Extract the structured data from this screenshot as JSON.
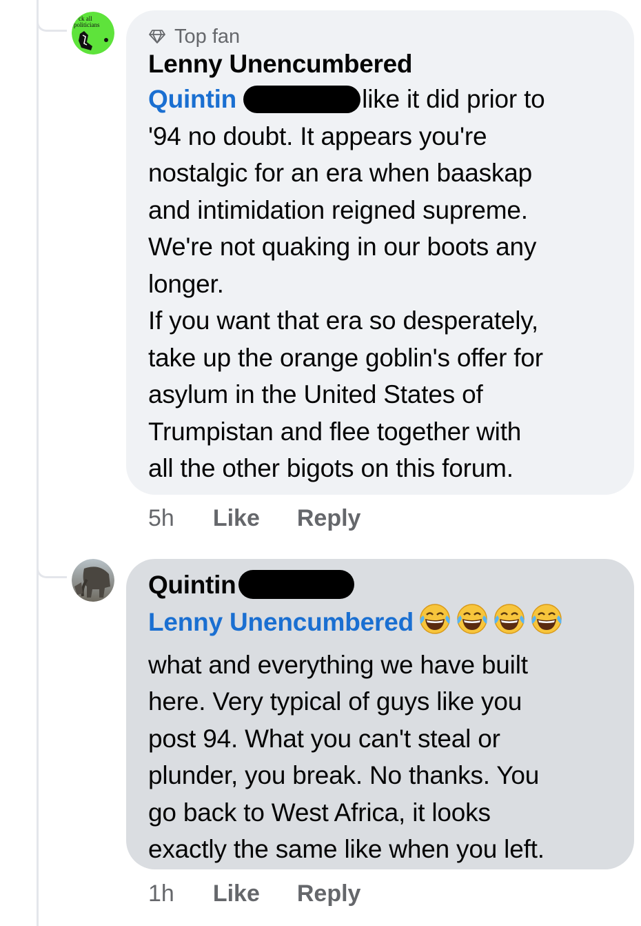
{
  "comments": [
    {
      "badge": "Top fan",
      "author": "Lenny Unencumbered",
      "avatar_text": [
        "ck all",
        "politicians"
      ],
      "mention": "Quintin",
      "text_first": "like it did prior to",
      "lines": [
        "'94 no doubt. It appears you're",
        "nostalgic for an era when baaskap",
        "and intimidation reigned supreme.",
        "We're not quaking in our boots any",
        "longer.",
        "If you want that era so desperately,",
        "take up the orange goblin's offer for",
        "asylum in the United States of",
        "Trumpistan and flee together with",
        "all the other bigots on this forum."
      ],
      "time": "5h",
      "like_label": "Like",
      "reply_label": "Reply"
    },
    {
      "author": "Quintin",
      "mention": "Lenny Unencumbered",
      "emoji": "😂😂😂😂",
      "lines": [
        "what and everything we have built",
        "here. Very typical of guys like you",
        "post 94. What you can't steal or",
        "plunder, you break. No thanks. You",
        "go back to West Africa, it looks",
        "exactly the same like when you left."
      ],
      "time": "1h",
      "like_label": "Like",
      "reply_label": "Reply"
    }
  ],
  "colors": {
    "mention": "#1a6fd1",
    "bubble_1": "#f0f2f5",
    "bubble_2": "#dadde1",
    "meta": "#65676b",
    "avatar_green": "#5ee33b"
  }
}
